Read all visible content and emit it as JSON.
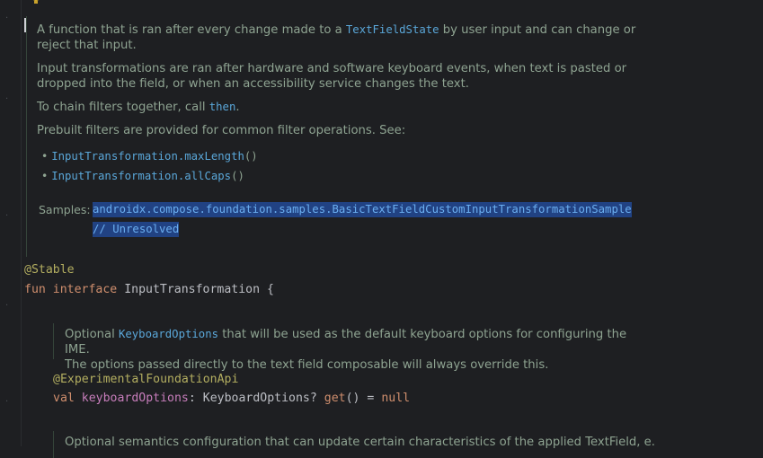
{
  "doc1": {
    "line1_pre": "A function that is ran after every change made to a ",
    "line1_link": "TextFieldState",
    "line1_post": " by user input and can change or",
    "line2": "reject that input.",
    "para2_l1": "Input transformations are ran after hardware and software keyboard events, when text is pasted or",
    "para2_l2": "dropped into the field, or when an accessibility service changes the text.",
    "para3_pre": "To chain filters together, call ",
    "para3_link": "then",
    "para3_post": ".",
    "para4": "Prebuilt filters are provided for common filter operations. See:",
    "bullets": [
      {
        "text": "InputTransformation.maxLength",
        "suffix": "()"
      },
      {
        "text": "InputTransformation.allCaps",
        "suffix": "()"
      }
    ],
    "samples_label": "Samples:",
    "samples_link": "androidx.compose.foundation.samples.BasicTextFieldCustomInputTransformationSample",
    "samples_comment": "// Unresolved"
  },
  "code": {
    "annotation": "@Stable",
    "decl_kw1": "fun",
    "decl_kw2": "interface",
    "decl_name": "InputTransformation",
    "decl_brace": "{",
    "member_annotation": "@ExperimentalFoundationApi",
    "member_kw": "val",
    "member_name": "keyboardOptions",
    "member_colon": ":",
    "member_type": "KeyboardOptions?",
    "member_get": "get",
    "member_rest": "() = ",
    "member_null": "null"
  },
  "doc2": {
    "line1_pre": "Optional ",
    "line1_link": "KeyboardOptions",
    "line1_post": " that will be used as the default keyboard options for configuring the IME.",
    "line2": "The options passed directly to the text field composable will always override this."
  },
  "doc3": {
    "line1": "Optional semantics configuration that can update certain characteristics of the applied TextField, e."
  }
}
